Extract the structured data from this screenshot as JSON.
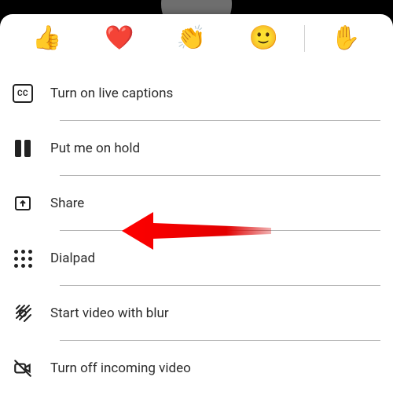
{
  "reactions": {
    "thumb": "👍",
    "heart": "❤️",
    "clap": "👏",
    "smile": "🙂",
    "raise_hand": "✋"
  },
  "menu": {
    "captions_label": "Turn on live captions",
    "hold_label": "Put me on hold",
    "share_label": "Share",
    "dialpad_label": "Dialpad",
    "blur_label": "Start video with blur",
    "incoming_off_label": "Turn off incoming video"
  }
}
